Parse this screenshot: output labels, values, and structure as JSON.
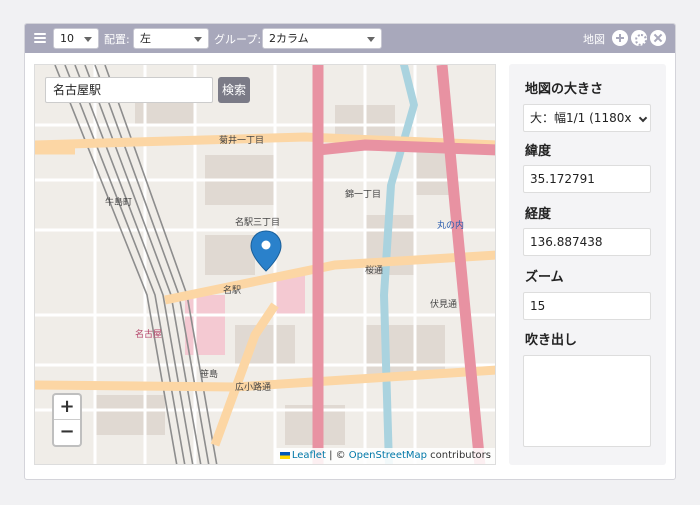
{
  "toolbar": {
    "count_value": "10",
    "align_label": "配置:",
    "align_value": "左",
    "group_label": "グループ:",
    "group_value": "2カラム",
    "title": "地図"
  },
  "map": {
    "search_value": "名古屋駅",
    "search_button": "検索",
    "zoom_in": "+",
    "zoom_out": "−",
    "attribution_leaflet": "Leaflet",
    "attribution_sep": " | © ",
    "attribution_osm": "OpenStreetMap",
    "attribution_tail": " contributors",
    "labels": {
      "kikui": "菊井一丁目",
      "nishiki": "錦一丁目",
      "ushijima": "牛島町",
      "meieki3": "名駅三丁目",
      "meieki": "名駅",
      "sakuradori": "桜通",
      "nagoya": "名古屋",
      "sasashima": "笹島",
      "hirokoji": "広小路通",
      "marunouchi": "丸の内",
      "fushimi": "伏見通"
    },
    "colors": {
      "major_road": "#e892a2",
      "secondary_road": "#fcd6a4",
      "water": "#aad3df",
      "rail": "#888888",
      "marker": "#2a81cb"
    }
  },
  "side": {
    "size_label": "地図の大きさ",
    "size_value": "大：幅1/1 (1180x",
    "lat_label": "緯度",
    "lat_value": "35.172791",
    "lng_label": "経度",
    "lng_value": "136.887438",
    "zoom_label": "ズーム",
    "zoom_value": "15",
    "popup_label": "吹き出し"
  }
}
